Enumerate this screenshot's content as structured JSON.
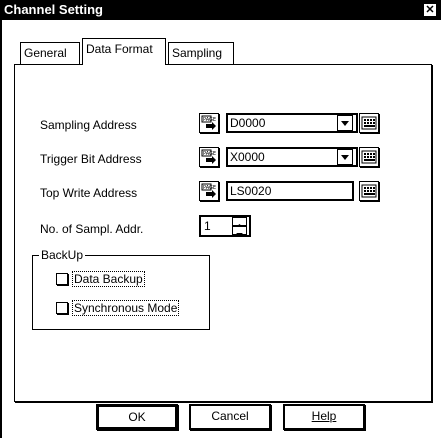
{
  "window": {
    "title": "Channel Setting",
    "close_symbol": "✕"
  },
  "tabs": [
    {
      "label": "General"
    },
    {
      "label": "Data Format"
    },
    {
      "label": "Sampling"
    }
  ],
  "fields": {
    "sampling_address": {
      "label": "Sampling Address",
      "value": "D0000"
    },
    "trigger_bit_address": {
      "label": "Trigger Bit Address",
      "value": "X0000"
    },
    "top_write_address": {
      "label": "Top Write Address",
      "value": "LS0020"
    },
    "num_sampl_addr": {
      "label": "No. of Sampl. Addr.",
      "value": "1"
    }
  },
  "backup": {
    "legend": "BackUp",
    "data_backup": {
      "label": "Data Backup",
      "checked": false
    },
    "synchronous_mode": {
      "label": "Synchronous Mode",
      "checked": false
    }
  },
  "buttons": {
    "ok": "OK",
    "cancel": "Cancel",
    "help": "Help"
  },
  "icons": {
    "address_icon": "page-address-icon",
    "keypad_icon": "keypad-icon",
    "dropdown_icon": "dropdown-arrow-icon"
  }
}
